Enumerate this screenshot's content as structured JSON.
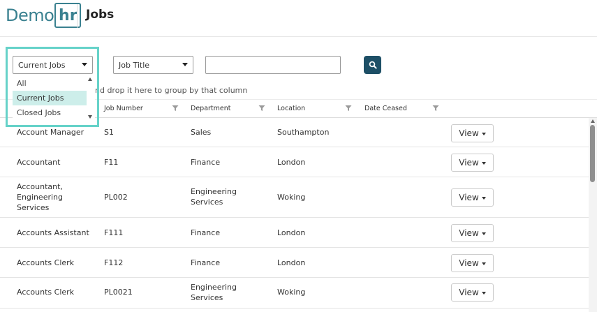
{
  "header": {
    "logo_demo": "Demo",
    "logo_hr": "hr",
    "title": "Jobs"
  },
  "filters": {
    "status_value": "Current Jobs",
    "status_options": [
      "All",
      "Current Jobs",
      "Closed Jobs"
    ],
    "field_value": "Job Title",
    "search_value": "",
    "search_icon": "search-icon"
  },
  "group_hint": "nd drop it here to group by that column",
  "table": {
    "columns": [
      "Job Number",
      "Department",
      "Location",
      "Date Ceased"
    ],
    "view_label": "View",
    "rows": [
      {
        "title": "Account Manager",
        "number": "S1",
        "department": "Sales",
        "location": "Southampton"
      },
      {
        "title": "Accountant",
        "number": "F11",
        "department": "Finance",
        "location": "London"
      },
      {
        "title": "Accountant, Engineering Services",
        "number": "PL002",
        "department": "Engineering Services",
        "location": "Woking"
      },
      {
        "title": "Accounts Assistant",
        "number": "F111",
        "department": "Finance",
        "location": "London"
      },
      {
        "title": "Accounts Clerk",
        "number": "F112",
        "department": "Finance",
        "location": "London"
      },
      {
        "title": "Accounts Clerk",
        "number": "PL0021",
        "department": "Engineering Services",
        "location": "Woking"
      }
    ]
  },
  "colors": {
    "brand": "#3a8190",
    "search_button": "#1d4f66",
    "highlight": "#66d2c9",
    "selected_option": "#cdeeea"
  }
}
